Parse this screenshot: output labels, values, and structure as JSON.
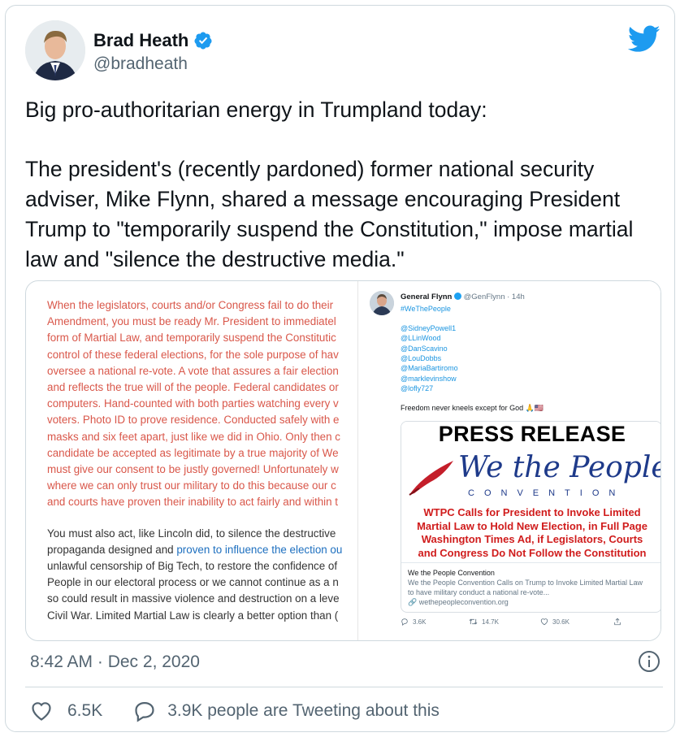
{
  "author": {
    "display_name": "Brad Heath",
    "handle": "@bradheath",
    "verified": true
  },
  "tweet": {
    "paragraphs": [
      "Big pro-authoritarian energy in Trumpland today:",
      "The president's (recently pardoned) former national security adviser, Mike Flynn, shared a message encouraging President Trump to \"temporarily suspend the Constitution,\" impose martial law and \"silence the destructive media.\""
    ]
  },
  "media": {
    "letter_lines": [
      "When the legislators, courts and/or Congress fail to do their",
      "Amendment, you must be ready Mr. President to immediatel",
      "form of Martial Law, and temporarily suspend the Constitutic",
      "control of these federal elections, for the sole purpose of hav",
      "oversee a national re-vote. A vote that assures a fair election",
      "and reflects the true will of the people. Federal candidates or",
      "computers. Hand-counted with both parties watching every v",
      "voters. Photo ID to prove residence. Conducted safely with e",
      "masks and six feet apart, just like we did in Ohio. Only then c",
      "candidate be accepted as legitimate by a true majority of We",
      "must give our consent to be justly governed! Unfortunately w",
      "where we can only trust our military to do this because our c",
      "and courts have proven their inability to act fairly and within t"
    ],
    "letter_lines_2": [
      {
        "a": "You must also act, like Lincoln did, to silence the destructive",
        "b": ""
      },
      {
        "a": "propaganda designed and ",
        "b": "proven to influence the election ou"
      },
      {
        "a": "unlawful censorship of Big Tech, to restore the confidence of",
        "b": ""
      },
      {
        "a": "People in our electoral process or we cannot continue as a n",
        "b": ""
      },
      {
        "a": "so could result in massive violence and destruction on a leve",
        "b": ""
      },
      {
        "a": "Civil War. Limited Martial Law is clearly a better option than (",
        "b": ""
      }
    ],
    "embedded_tweet": {
      "name": "General Flynn",
      "handle": "@GenFlynn",
      "time": "· 14h",
      "hashtag": "#WeThePeople",
      "mentions": [
        "@SidneyPowell1",
        "@LLinWood",
        "@DanScavino",
        "@LouDobbs",
        "@MariaBartiromo",
        "@marklevinshow",
        "@lofly727"
      ],
      "text": "Freedom never kneels except for God 🙏🇺🇸",
      "press_release_title": "PRESS RELEASE",
      "wtp_logo": "We the People",
      "wtp_sub": "CONVENTION",
      "red_headline": [
        "WTPC Calls for President to Invoke Limited",
        "Martial Law to Hold New Election, in Full Page",
        "Washington Times Ad, if Legislators, Courts",
        "and Congress Do Not Follow the Constitution"
      ],
      "card_title": "We the People Convention",
      "card_desc_1": "We the People Convention Calls on Trump to Invoke Limited Martial Law",
      "card_desc_2": "to have military conduct a national re-vote...",
      "card_url": "wethepeopleconvention.org",
      "replies": "3.6K",
      "retweets": "14.7K",
      "likes": "30.6K"
    }
  },
  "timestamp": "8:42 AM · Dec 2, 2020",
  "stats": {
    "likes": "6.5K",
    "tweeting": "3.9K people are Tweeting about this"
  },
  "colors": {
    "verified_blue": "#1d9bf0",
    "twitter_blue": "#1d9bf0",
    "secondary_text": "#536471",
    "letter_red": "#d9574a"
  }
}
